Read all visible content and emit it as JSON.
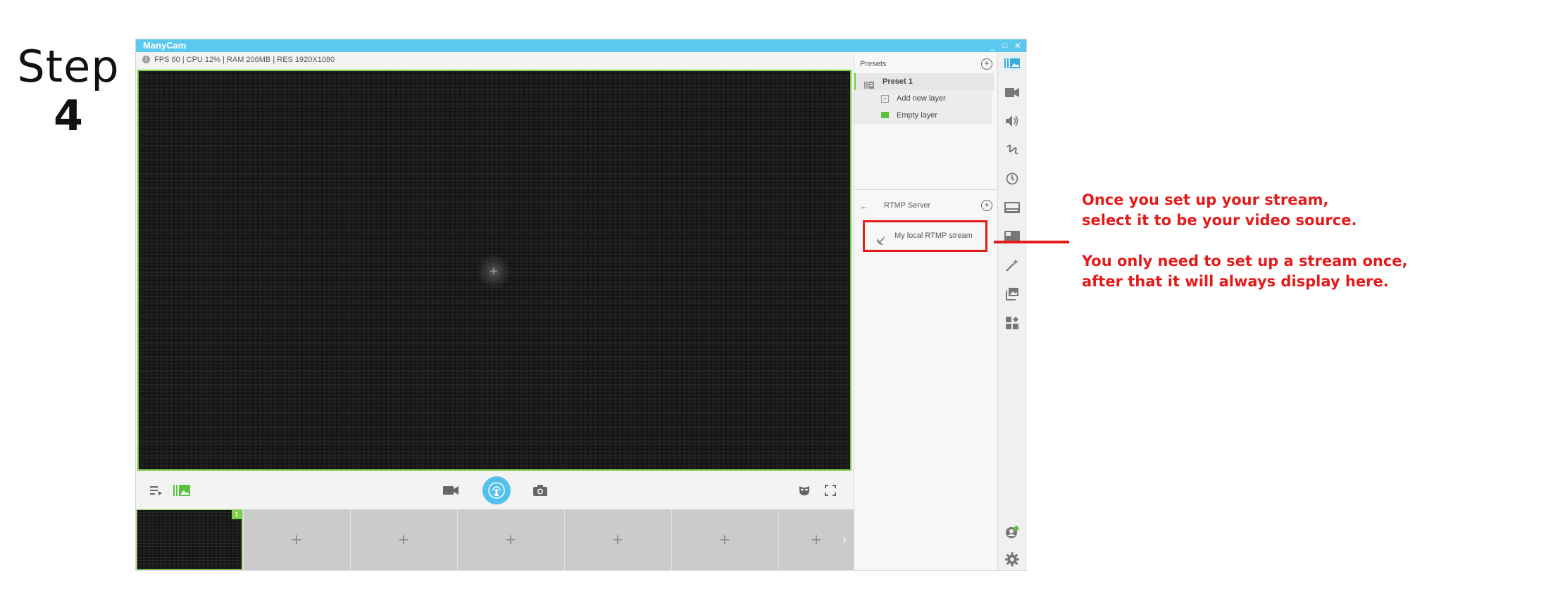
{
  "step": {
    "word": "Step",
    "number": "4"
  },
  "window": {
    "title": "ManyCam",
    "controls": {
      "minimize": "_",
      "maximize": "□",
      "close": "✕"
    }
  },
  "infobar": {
    "text": "FPS 60 | CPU 12% | RAM 206MB | RES 1920X1080"
  },
  "preview": {
    "add_source": "+"
  },
  "thumbnails": {
    "first_badge": "1",
    "slots": [
      "+",
      "+",
      "+",
      "+",
      "+",
      "+"
    ],
    "next_arrow": "›"
  },
  "presets": {
    "header": "Presets",
    "add": "+",
    "preset_name": "Preset 1",
    "add_layer": "Add new layer",
    "layer_name": "Empty layer"
  },
  "rtmp": {
    "back": "←",
    "header": "RTMP Server",
    "add": "+",
    "item": "My local RTMP stream"
  },
  "annotation": {
    "line1": "Once you set up your stream,",
    "line2": "select it to be your video source.",
    "line3": "You only need to set up a stream once,",
    "line4": "after that it will always display here."
  },
  "colors": {
    "accent": "#53c1ec",
    "active": "#79d046",
    "annotation": "#e31b1b"
  },
  "icons": [
    "presets-icon",
    "video-sources-icon",
    "audio-icon",
    "draw-icon",
    "clock-icon",
    "lower-thirds-icon",
    "chroma-key-icon",
    "effects-icon",
    "picture-in-picture-icon",
    "widgets-icon",
    "account-icon",
    "settings-icon"
  ]
}
